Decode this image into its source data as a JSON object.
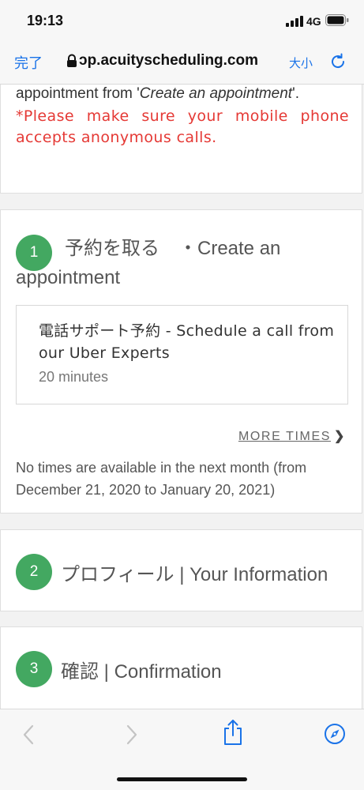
{
  "status_bar": {
    "time": "19:13",
    "network": "4G"
  },
  "browser": {
    "done_label": "完了",
    "url": "ɔp.acuityscheduling.com",
    "text_size_label": "大小"
  },
  "intro": {
    "line_prefix": "appointment from '",
    "line_italic": "Create an appointment",
    "line_suffix": "'.",
    "warning": "*Please make sure your mobile phone accepts anonymous calls."
  },
  "steps": [
    {
      "number": "1",
      "title": "予約を取る　・Create an appointment"
    },
    {
      "number": "2",
      "title": "プロフィール | Your Information"
    },
    {
      "number": "3",
      "title": "確認 | Confirmation"
    }
  ],
  "service": {
    "name": "電話サポート予約 - Schedule a call from our Uber Experts",
    "duration": "20 minutes"
  },
  "more_times_label": "MORE TIMES",
  "no_times_message": "No times are available in the next month (from December 21, 2020 to January 20, 2021)",
  "colors": {
    "step_circle": "#43a861",
    "warning_text": "#e53935",
    "ios_blue": "#1a73e8"
  },
  "icons": [
    "signal-icon",
    "battery-icon",
    "lock-icon",
    "reload-icon",
    "back-icon",
    "forward-icon",
    "share-icon",
    "compass-icon",
    "chevron-right-icon"
  ]
}
